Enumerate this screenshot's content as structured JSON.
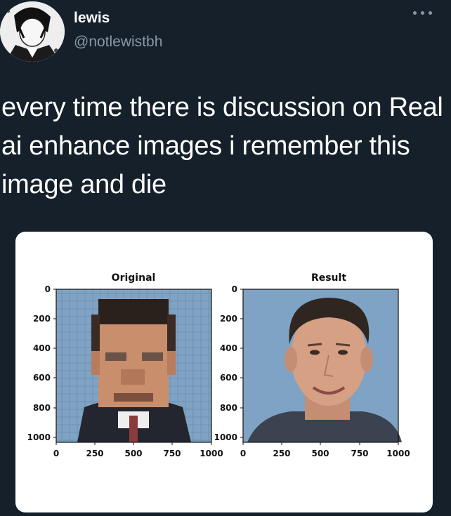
{
  "tweet": {
    "user_name": "lewis",
    "user_handle": "@notlewistbh",
    "text": "every time there is discussion on Real ai enhance images i remember this image and die",
    "more_icon": "more-horizontal-icon"
  },
  "figure": {
    "panels": [
      {
        "title": "Original",
        "x_ticks": [
          "0",
          "250",
          "500",
          "750",
          "1000"
        ],
        "y_ticks": [
          "0",
          "200",
          "400",
          "600",
          "800",
          "1000"
        ]
      },
      {
        "title": "Result",
        "x_ticks": [
          "0",
          "250",
          "500",
          "750",
          "1000"
        ],
        "y_ticks": [
          "0",
          "200",
          "400",
          "600",
          "800",
          "1000"
        ]
      }
    ]
  },
  "colors": {
    "background": "#15202b",
    "secondary_text": "#8899a6",
    "card": "#ffffff",
    "photo_background": "#7fa3c4"
  }
}
